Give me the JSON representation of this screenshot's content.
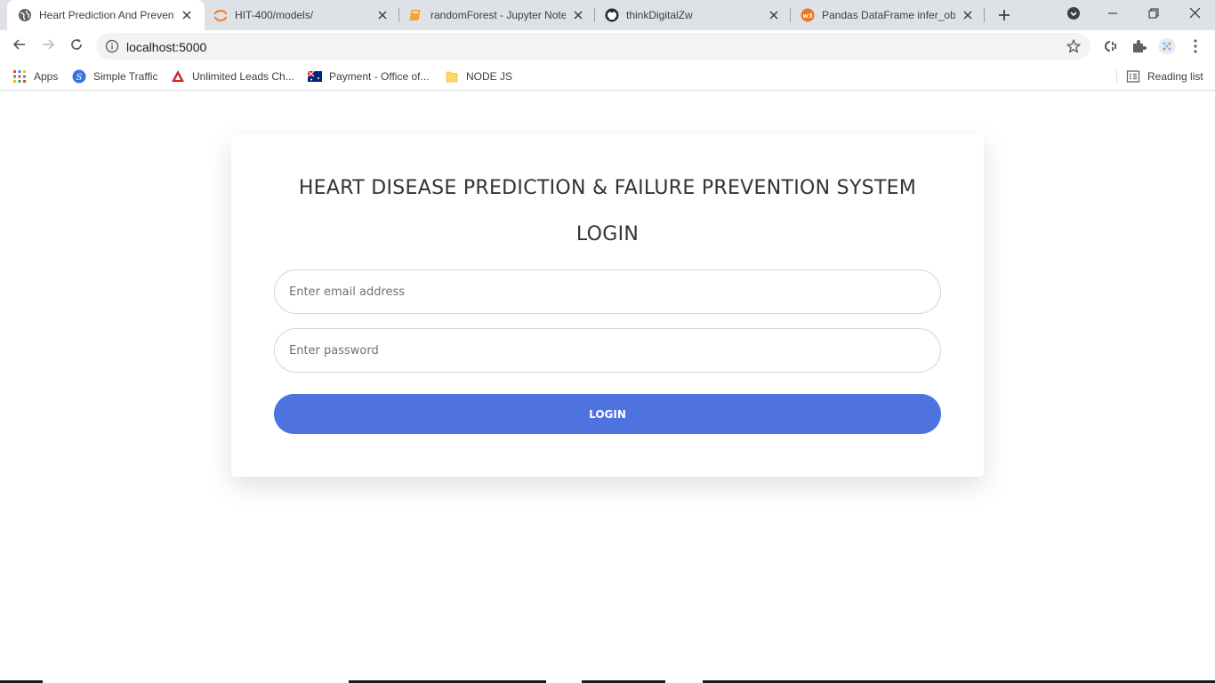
{
  "browser": {
    "tabs": [
      {
        "title": "Heart Prediction And Prevent",
        "icon": "globe-icon",
        "active": true
      },
      {
        "title": "HIT-400/models/",
        "icon": "jupyter-icon",
        "active": false
      },
      {
        "title": "randomForest - Jupyter Noteb",
        "icon": "notebook-icon",
        "active": false
      },
      {
        "title": "thinkDigitalZw",
        "icon": "github-icon",
        "active": false
      },
      {
        "title": "Pandas DataFrame infer_obje",
        "icon": "pandas-site-icon",
        "active": false
      }
    ],
    "url": "localhost:5000",
    "bookmarks": [
      {
        "label": "Apps",
        "icon": "apps-grid-icon"
      },
      {
        "label": "Simple Traffic",
        "icon": "simple-traffic-icon"
      },
      {
        "label": "Unlimited Leads Ch...",
        "icon": "leads-icon"
      },
      {
        "label": "Payment - Office of...",
        "icon": "flag-icon"
      },
      {
        "label": "NODE JS",
        "icon": "folder-icon"
      }
    ],
    "reading_list": "Reading list"
  },
  "page": {
    "system_title": "HEART DISEASE PREDICTION & FAILURE PREVENTION SYSTEM",
    "form_title": "LOGIN",
    "email_placeholder": "Enter email address",
    "password_placeholder": "Enter password",
    "login_button": "LOGIN"
  },
  "colors": {
    "accent": "#4e73df",
    "tabstrip": "#dee1e6"
  }
}
